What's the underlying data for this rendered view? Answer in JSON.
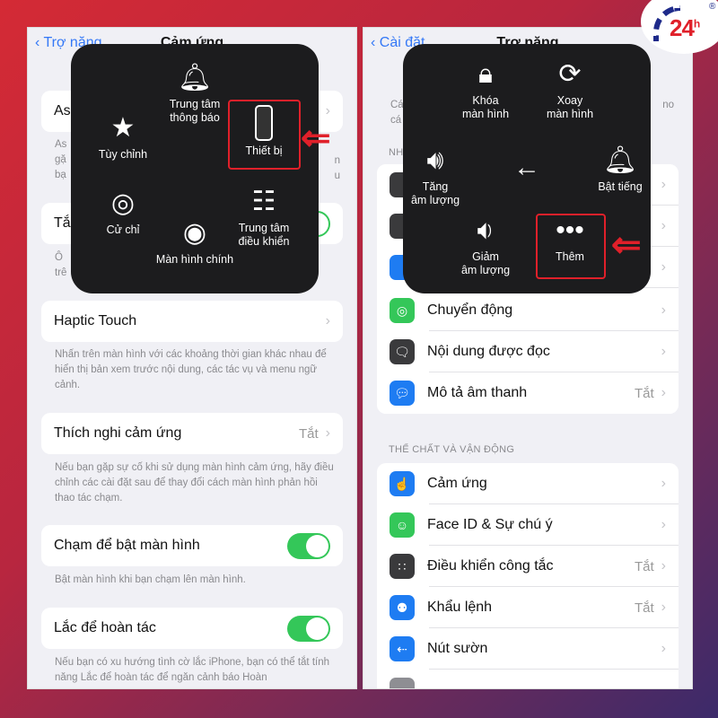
{
  "left": {
    "nav": {
      "back": "Trợ năng",
      "title": "Cảm ứng"
    },
    "rows": [
      {
        "label": "As",
        "fragment": true
      },
      {
        "label": "Tắ",
        "fragment": true
      },
      {
        "label": "Haptic Touch"
      },
      {
        "label": "Thích nghi cảm ứng",
        "value": "Tắt"
      },
      {
        "label": "Chạm để bật màn hình",
        "toggle": true
      },
      {
        "label": "Lắc để hoàn tác",
        "toggle": true
      }
    ],
    "descs": [
      "As\ngặ\nbạ",
      "Ô\ntrê",
      "Nhấn trên màn hình với các khoảng thời gian khác nhau để hiển thị bản xem trước nội dung, các tác vụ và menu ngữ cảnh.",
      "Nếu bạn gặp sự cố khi sử dụng màn hình cảm ứng, hãy điều chỉnh các cài đặt sau để thay đổi cách màn hình phản hồi thao tác chạm.",
      "Bật màn hình khi bạn chạm lên màn hình.",
      "Nếu bạn có xu hướng tình cờ lắc iPhone, bạn có thể tắt tính năng Lắc để hoàn tác để ngăn cảnh báo Hoàn"
    ],
    "partial_right": [
      "n",
      "u"
    ],
    "popup": {
      "notification": "Trung tâm\nthông báo",
      "custom": "Tùy chỉnh",
      "device": "Thiết bị",
      "gestures": "Cử chỉ",
      "control": "Trung tâm\nđiều khiển",
      "home": "Màn hình chính"
    }
  },
  "right": {
    "nav": {
      "back": "Cài đặt",
      "title": "Trợ năng"
    },
    "desc_fragment": "Cá\ncá",
    "desc_fragment_right": "no",
    "section1_fragment": "NH",
    "rows1": [
      {
        "label": "Chuyển động",
        "icon": "motion-icon",
        "color": "#34c759"
      },
      {
        "label": "Nội dung được đọc",
        "icon": "spoken-content-icon",
        "color": "#3a3a3c"
      },
      {
        "label": "Mô tả âm thanh",
        "value": "Tắt",
        "icon": "audio-description-icon",
        "color": "#1e7cf2"
      }
    ],
    "section2": "THỂ CHẤT VÀ VẬN ĐỘNG",
    "rows2": [
      {
        "label": "Cảm ứng",
        "icon": "touch-icon",
        "color": "#1e7cf2"
      },
      {
        "label": "Face ID & Sự chú ý",
        "icon": "face-id-icon",
        "color": "#34c759"
      },
      {
        "label": "Điều khiển công tắc",
        "value": "Tắt",
        "icon": "switch-control-icon",
        "color": "#3a3a3c"
      },
      {
        "label": "Khẩu lệnh",
        "value": "Tắt",
        "icon": "voice-control-icon",
        "color": "#1e7cf2"
      },
      {
        "label": "Nút sườn",
        "icon": "side-button-icon",
        "color": "#1e7cf2"
      }
    ],
    "popup": {
      "lock": "Khóa\nmàn hình",
      "rotate": "Xoay\nmàn hình",
      "volume_up": "Tăng\nâm lượng",
      "mute": "Bật tiếng",
      "volume_down": "Giảm\nâm lượng",
      "more": "Thêm"
    }
  },
  "logo": {
    "text": "24h",
    "mark": "®"
  },
  "colors": {
    "accent": "#3478f6",
    "toggle_on": "#34c759",
    "highlight": "#e0202a"
  }
}
